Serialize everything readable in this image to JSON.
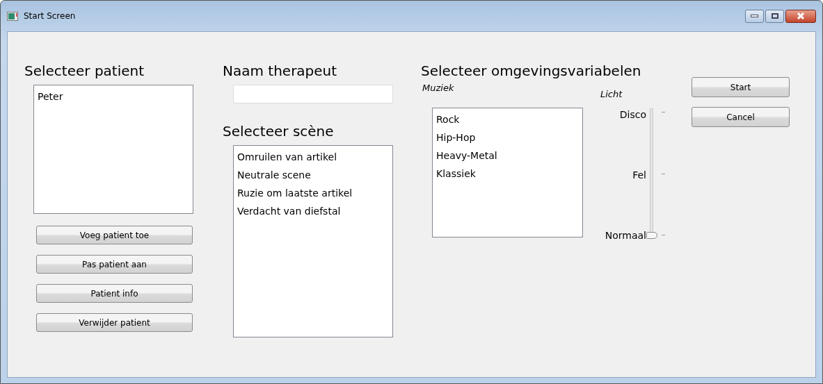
{
  "window": {
    "title": "Start Screen"
  },
  "patient": {
    "heading": "Selecteer patient",
    "items": [
      {
        "label": "Peter",
        "selected": false
      }
    ],
    "buttons": [
      "Voeg patient toe",
      "Pas patient aan",
      "Patient info",
      "Verwijder patient"
    ]
  },
  "therapist": {
    "heading": "Naam therapeut"
  },
  "scene": {
    "heading": "Selecteer scène",
    "items": [
      {
        "label": "Omruilen van artikel",
        "selected": false
      },
      {
        "label": "Neutrale scene",
        "selected": false
      },
      {
        "label": "Ruzie om laatste artikel",
        "selected": false
      },
      {
        "label": "Verdacht van diefstal",
        "selected": false
      }
    ]
  },
  "environment": {
    "heading": "Selecteer omgevingsvariabelen",
    "music_label": "Muziek",
    "music": [
      {
        "label": "Rock",
        "selected": false
      },
      {
        "label": "Hip-Hop",
        "selected": false
      },
      {
        "label": "Heavy-Metal",
        "selected": false
      },
      {
        "label": "Klassiek",
        "selected": false
      }
    ],
    "light_label": "Licht",
    "light_levels": [
      "Disco",
      "Fel",
      "Normaal"
    ],
    "light": {
      "level": 0
    }
  },
  "buttons": [
    "Start",
    "Cancel"
  ]
}
